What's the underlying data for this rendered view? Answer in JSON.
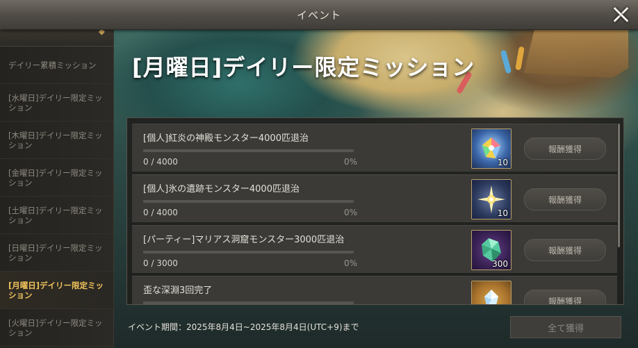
{
  "window": {
    "title": "イベント"
  },
  "sidebar": {
    "items": [
      {
        "label": "デイリー累積ミッション",
        "active": false
      },
      {
        "label": "[水曜日]デイリー限定ミッション",
        "active": false
      },
      {
        "label": "[木曜日]デイリー限定ミッション",
        "active": false
      },
      {
        "label": "[金曜日]デイリー限定ミッション",
        "active": false
      },
      {
        "label": "[土曜日]デイリー限定ミッション",
        "active": false
      },
      {
        "label": "[日曜日]デイリー限定ミッション",
        "active": false
      },
      {
        "label": "[月曜日]デイリー限定ミッション",
        "active": true
      },
      {
        "label": "[火曜日]デイリー限定ミッション",
        "active": false
      }
    ]
  },
  "main": {
    "title": "[月曜日]デイリー限定ミッション",
    "missions": [
      {
        "name": "[個人]紅炎の神殿モンスター4000匹退治",
        "count": "0 / 4000",
        "percent": "0%",
        "progress": 0,
        "reward_icon": "rainbow-crystal-icon",
        "reward_qty": "10",
        "button": "報酬獲得"
      },
      {
        "name": "[個人]氷の遺跡モンスター4000匹退治",
        "count": "0 / 4000",
        "percent": "0%",
        "progress": 0,
        "reward_icon": "star-shard-icon",
        "reward_qty": "10",
        "button": "報酬獲得"
      },
      {
        "name": "[パーティー]マリアス洞窟モンスター3000匹退治",
        "count": "0 / 3000",
        "percent": "0%",
        "progress": 0,
        "reward_icon": "green-gem-icon",
        "reward_qty": "300",
        "button": "報酬獲得"
      },
      {
        "name": "歪な深淵3回完了",
        "count": "",
        "percent": "",
        "progress": 0,
        "reward_icon": "ice-crystal-icon",
        "reward_qty": "",
        "button": "報酬獲得"
      }
    ],
    "period": "イベント期間：2025年8月4日~2025年8月4日(UTC+9)まで",
    "claim_all": "全て獲得"
  },
  "colors": {
    "active_tab": "#f1c25b",
    "accent_border": "#b9a06a"
  }
}
